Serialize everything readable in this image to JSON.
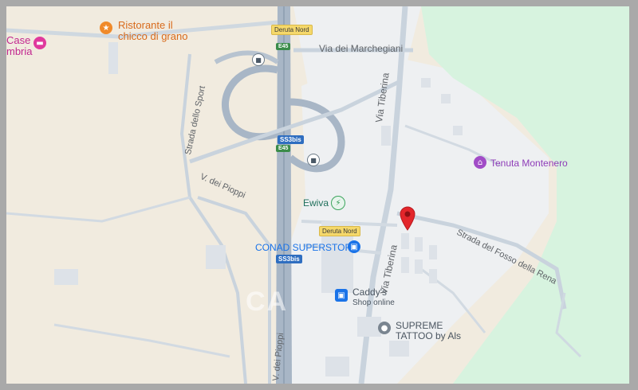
{
  "map": {
    "places": {
      "case_umbria": "Case\nmbria",
      "ristorante": "Ristorante il\nchicco di grano",
      "tenuta": "Tenuta Montenero",
      "ewiva": "Ewiva",
      "conad": "CONAD SUPERSTORE",
      "caddys_name": "Caddy's",
      "caddys_sub": "Shop online",
      "tattoo": "SUPREME\nTATTOO by Als"
    },
    "roads": {
      "marchegiani": "Via dei Marchegiani",
      "tiberina_top": "Via Tiberina",
      "tiberina_bottom": "Via Tiberina",
      "sport": "Strada dello Sport",
      "pioppi_left": "V. dei Pioppi",
      "pioppi_bottom": "V. dei Pioppi",
      "fosso": "Strada del Fosso della Rena"
    },
    "shields": {
      "deruta_top": "Deruta Nord",
      "deruta_mid": "Deruta Nord",
      "e45_top": "E45",
      "e45_mid": "E45",
      "ss3bis_top": "SS3bis",
      "ss3bis_mid": "SS3bis"
    },
    "icons": {
      "bus": "bus-stop-icon",
      "hotel": "bed-icon",
      "restaurant": "fork-knife-icon",
      "charging": "bolt-icon",
      "cart": "cart-icon",
      "shop": "shopping-bag-icon",
      "tattoo": "pin-icon",
      "winery": "house-icon",
      "marker": "location-marker-icon"
    },
    "watermark": "CA",
    "colors": {
      "land": "#f1ebdf",
      "urban": "#eff1f3",
      "park": "#d8f3e1",
      "road": "#c9d3dd",
      "highway": "#a8b6c6",
      "marker": "#e3262b"
    }
  }
}
